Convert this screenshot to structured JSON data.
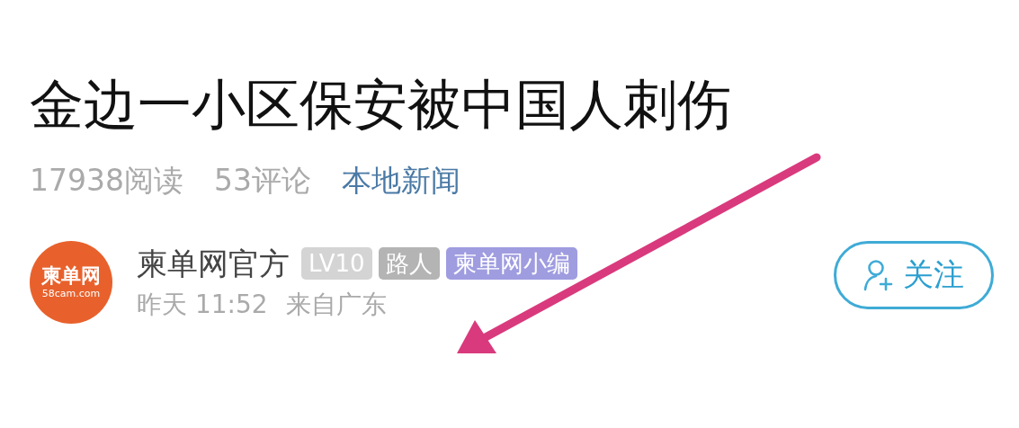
{
  "article": {
    "title": "金边一小区保安被中国人刺伤",
    "reads": "17938阅读",
    "comments": "53评论",
    "category": "本地新闻"
  },
  "author": {
    "avatar_logo": "柬单网",
    "avatar_site": "58cam.com",
    "name": "柬单网官方",
    "tags": [
      {
        "label": "LV10",
        "color": "#d4d4d4"
      },
      {
        "label": "路人",
        "color": "#b4b4b4"
      },
      {
        "label": "柬单网小编",
        "color": "#9f9ce0"
      }
    ],
    "time": "昨天 11:52",
    "location": "来自广东"
  },
  "follow_button": {
    "label": "关注"
  }
}
